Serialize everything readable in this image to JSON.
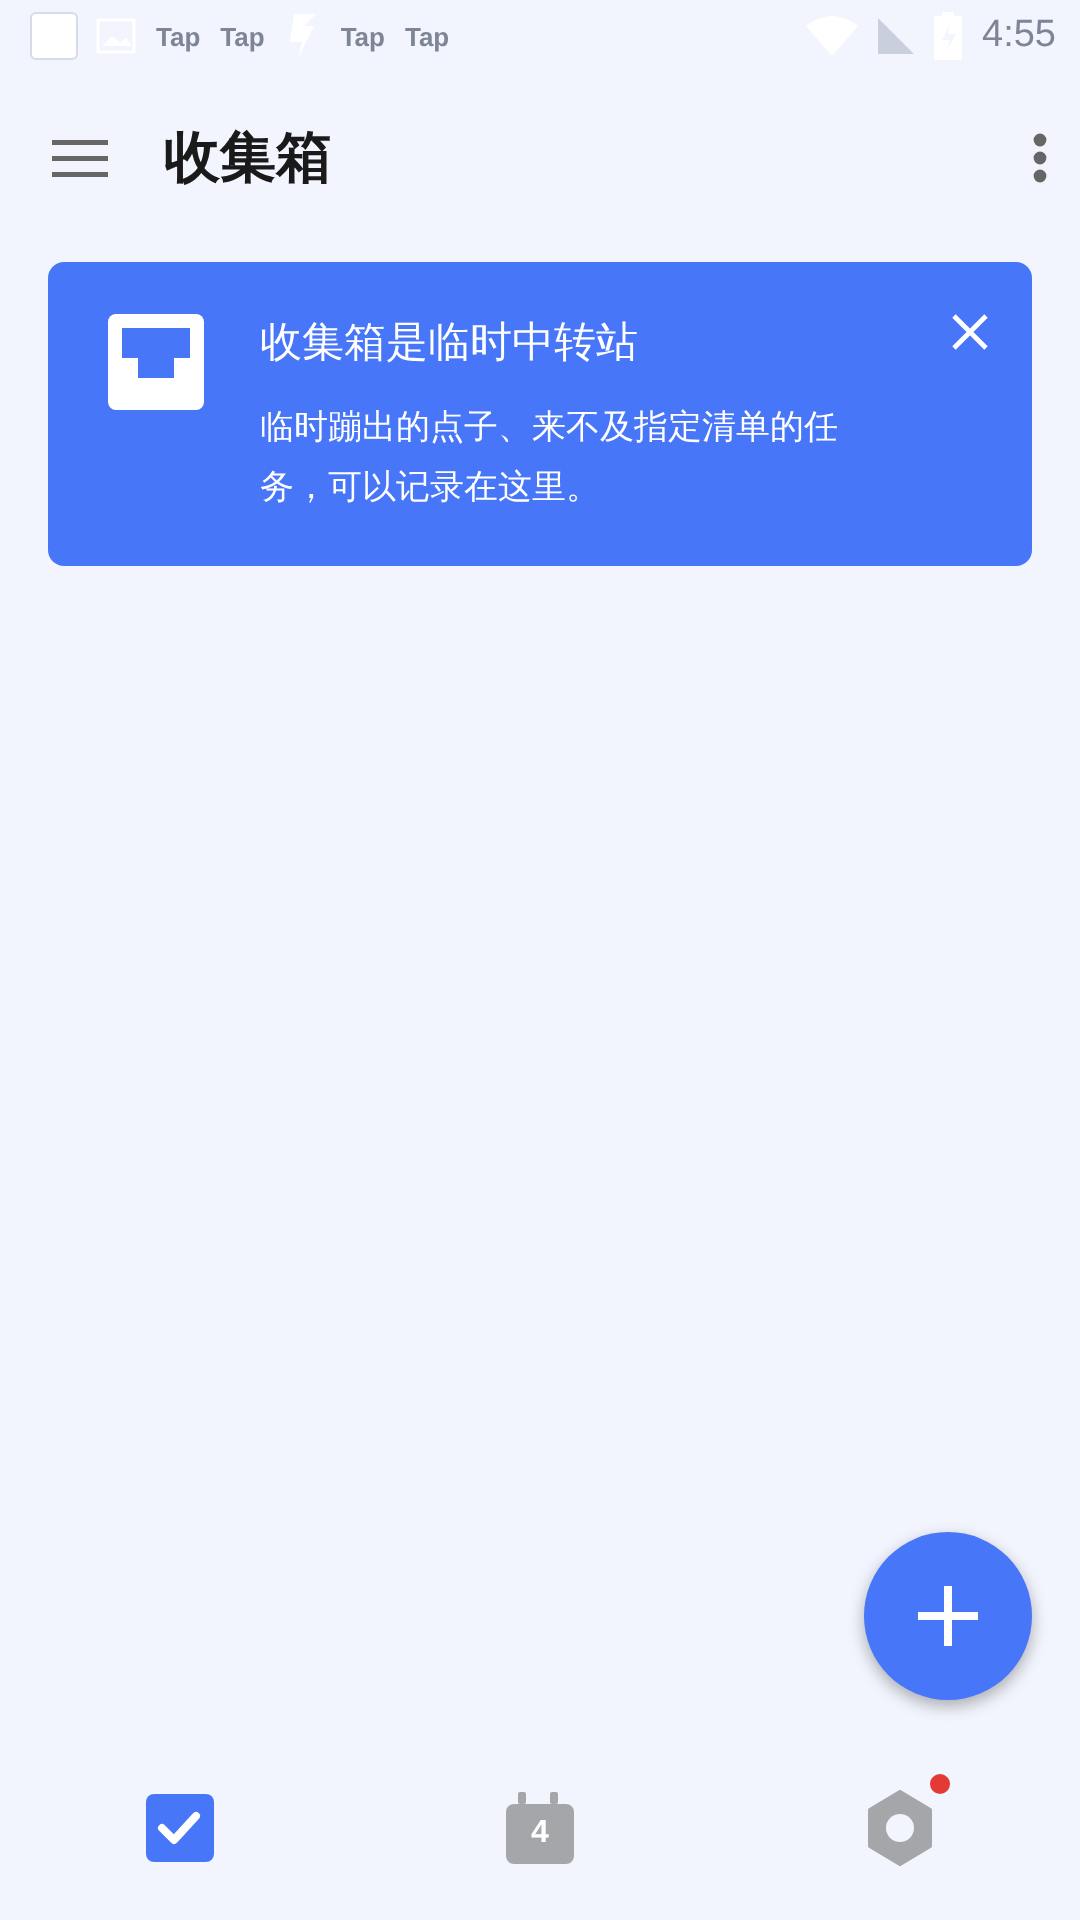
{
  "status_bar": {
    "notifications": [
      "Tap",
      "Tap",
      "Tap",
      "Tap"
    ],
    "time": "4:55"
  },
  "app_bar": {
    "title": "收集箱"
  },
  "info_card": {
    "title": "收集箱是临时中转站",
    "body": "临时蹦出的点子、来不及指定清单的任务，可以记录在这里。"
  },
  "bottom_nav": [
    {
      "kind": "tasks",
      "selected": true,
      "badge": false
    },
    {
      "kind": "calendar",
      "label": "4",
      "selected": false,
      "badge": false
    },
    {
      "kind": "settings",
      "selected": false,
      "badge": true
    }
  ]
}
